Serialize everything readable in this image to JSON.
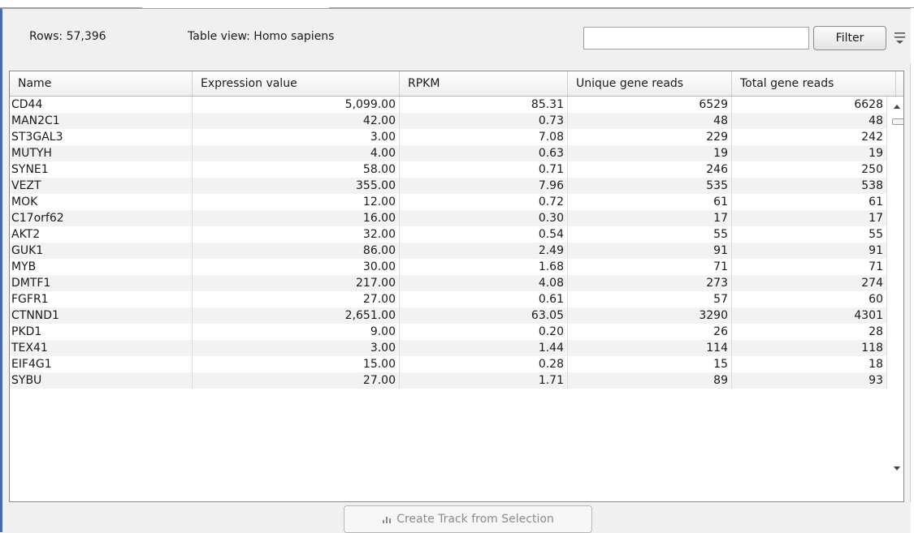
{
  "toolbar": {
    "rows_label": "Rows: 57,396",
    "table_view_label": "Table view: Homo sapiens",
    "filter_input_value": "",
    "filter_button_label": "Filter",
    "menu_icon": "hamburger-menu-icon"
  },
  "table": {
    "columns": [
      "Name",
      "Expression value",
      "RPKM",
      "Unique gene reads",
      "Total gene reads"
    ],
    "rows": [
      [
        "CD44",
        "5,099.00",
        "85.31",
        "6529",
        "6628"
      ],
      [
        "MAN2C1",
        "42.00",
        "0.73",
        "48",
        "48"
      ],
      [
        "ST3GAL3",
        "3.00",
        "7.08",
        "229",
        "242"
      ],
      [
        "MUTYH",
        "4.00",
        "0.63",
        "19",
        "19"
      ],
      [
        "SYNE1",
        "58.00",
        "0.71",
        "246",
        "250"
      ],
      [
        "VEZT",
        "355.00",
        "7.96",
        "535",
        "538"
      ],
      [
        "MOK",
        "12.00",
        "0.72",
        "61",
        "61"
      ],
      [
        "C17orf62",
        "16.00",
        "0.30",
        "17",
        "17"
      ],
      [
        "AKT2",
        "32.00",
        "0.54",
        "55",
        "55"
      ],
      [
        "GUK1",
        "86.00",
        "2.49",
        "91",
        "91"
      ],
      [
        "MYB",
        "30.00",
        "1.68",
        "71",
        "71"
      ],
      [
        "DMTF1",
        "217.00",
        "4.08",
        "273",
        "274"
      ],
      [
        "FGFR1",
        "27.00",
        "0.61",
        "57",
        "60"
      ],
      [
        "CTNND1",
        "2,651.00",
        "63.05",
        "3290",
        "4301"
      ],
      [
        "PKD1",
        "9.00",
        "0.20",
        "26",
        "28"
      ],
      [
        "TEX41",
        "3.00",
        "1.44",
        "114",
        "118"
      ],
      [
        "EIF4G1",
        "15.00",
        "0.28",
        "15",
        "18"
      ],
      [
        "SYBU",
        "27.00",
        "1.71",
        "89",
        "93"
      ]
    ]
  },
  "bottom": {
    "create_track_label": "Create Track from Selection",
    "create_track_icon": "bar-chart-icon"
  }
}
